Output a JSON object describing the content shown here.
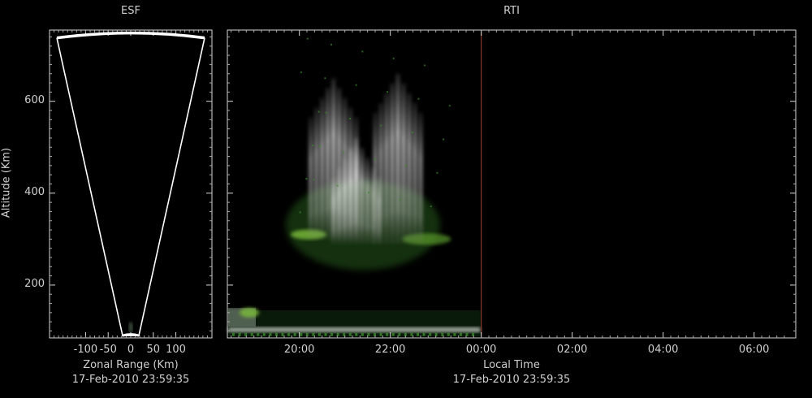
{
  "esf": {
    "title": "ESF",
    "xlabel": "Zonal Range (Km)",
    "ylabel": "Altitude (Km)",
    "timestamp": "17-Feb-2010 23:59:35",
    "xticks": [
      {
        "value": -100,
        "label": "-100"
      },
      {
        "value": -50,
        "label": "-50"
      },
      {
        "value": 0,
        "label": "0"
      },
      {
        "value": 50,
        "label": "50"
      },
      {
        "value": 100,
        "label": "100"
      }
    ],
    "yticks": [
      {
        "value": 200,
        "label": "200"
      },
      {
        "value": 400,
        "label": "400"
      },
      {
        "value": 600,
        "label": "600"
      }
    ]
  },
  "rti": {
    "title": "RTI",
    "xlabel": "Local Time",
    "timestamp": "17-Feb-2010 23:59:35",
    "xticks": [
      {
        "value": 20,
        "label": "20:00"
      },
      {
        "value": 22,
        "label": "22:00"
      },
      {
        "value": 24,
        "label": "00:00"
      },
      {
        "value": 26,
        "label": "02:00"
      },
      {
        "value": 28,
        "label": "04:00"
      },
      {
        "value": 30,
        "label": "06:00"
      }
    ],
    "current_time_line": "00:00"
  },
  "chart_data": [
    {
      "type": "heatmap",
      "title": "ESF",
      "xlabel": "Zonal Range (Km)",
      "ylabel": "Altitude (Km)",
      "xlim": [
        -180,
        180
      ],
      "ylim": [
        85,
        755
      ],
      "fan_beam_limits_km": {
        "min_altitude": 90,
        "max_altitude": 745
      }
    },
    {
      "type": "heatmap",
      "title": "RTI",
      "xlabel": "Local Time",
      "ylabel": "Altitude (Km)",
      "xlim": [
        "18:25",
        "06:55"
      ],
      "ylim": [
        85,
        755
      ],
      "plumes": [
        {
          "time": "20:45",
          "alt_low": 300,
          "alt_high": 650
        },
        {
          "time": "21:15",
          "alt_low": 290,
          "alt_high": 520
        },
        {
          "time": "22:10",
          "alt_low": 290,
          "alt_high": 660
        }
      ],
      "colors": {
        "echo_strong": "#ffffff",
        "echo_weak": "#3a8a2a",
        "now_line": "#8a3b2a"
      }
    }
  ]
}
